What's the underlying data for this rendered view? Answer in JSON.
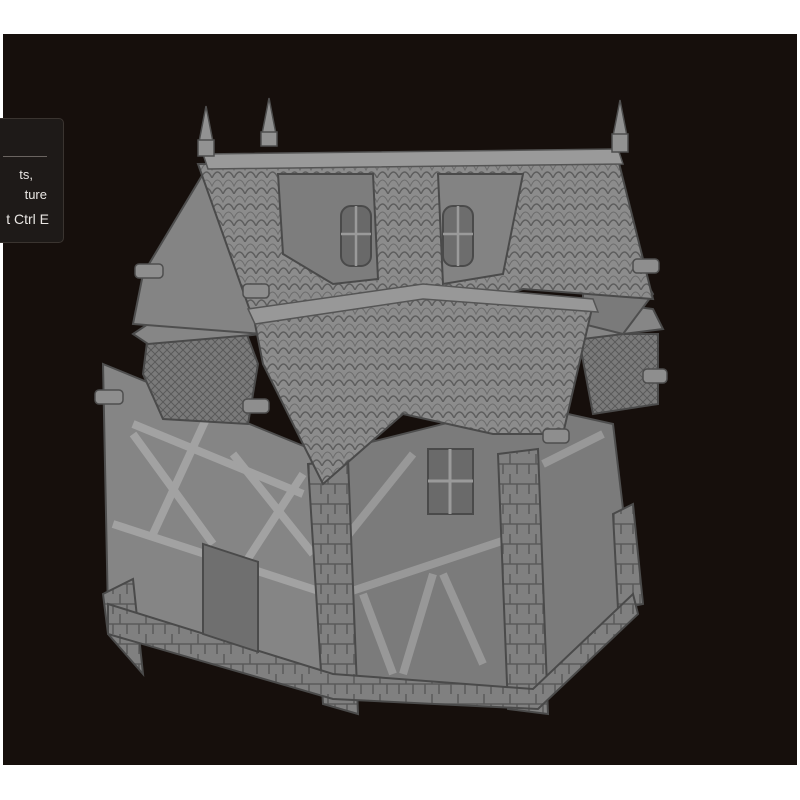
{
  "viewport": {
    "background": "#160f0c",
    "model_color": "#8a8a8a"
  },
  "tooltip": {
    "line1": "ts,",
    "line2": "ture",
    "shortcut": "t Ctrl E"
  }
}
